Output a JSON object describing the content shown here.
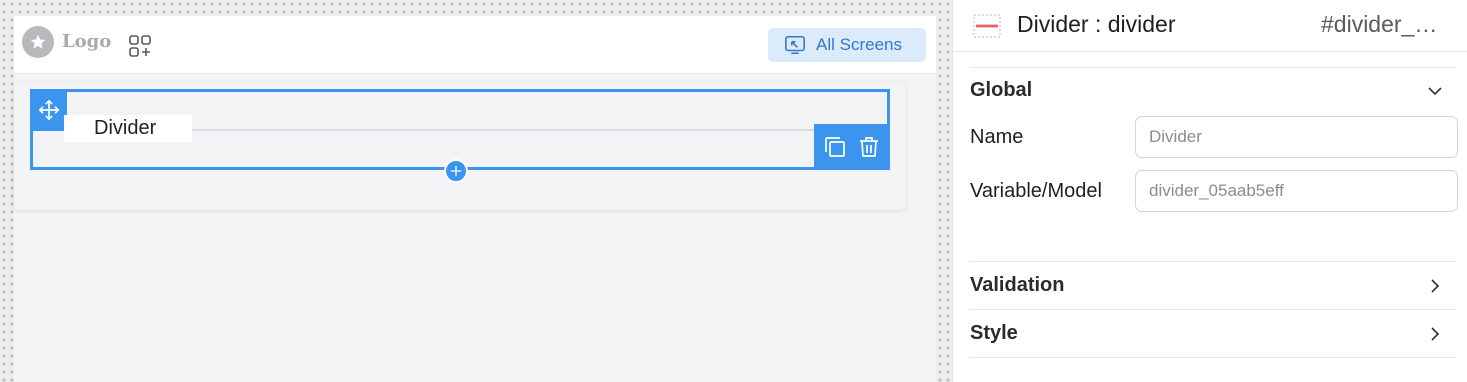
{
  "app": {
    "logo_text": "Logo",
    "logo_icon": "star-icon",
    "apps_icon": "apps-add-icon",
    "all_screens_label": "All Screens",
    "all_screens_icon": "screen-pointer-icon"
  },
  "canvas": {
    "component_label": "Divider",
    "move_icon": "move-arrows-icon",
    "copy_icon": "copy-icon",
    "delete_icon": "trash-icon",
    "add_icon": "plus-icon"
  },
  "panel": {
    "component_icon": "divider-component-icon",
    "title": "Divider : divider",
    "component_id": "#divider_…",
    "sections": {
      "global": {
        "title": "Global",
        "expanded": true
      },
      "validation": {
        "title": "Validation",
        "expanded": false
      },
      "style": {
        "title": "Style",
        "expanded": false
      }
    },
    "fields": {
      "name": {
        "label": "Name",
        "placeholder": "Divider"
      },
      "variable": {
        "label": "Variable/Model",
        "placeholder": "divider_05aab5eff"
      }
    }
  },
  "colors": {
    "accent": "#3b95ee",
    "accent_light": "#dcebfb",
    "accent_text": "#2f77d1",
    "divider_icon_red": "#e5484d"
  }
}
